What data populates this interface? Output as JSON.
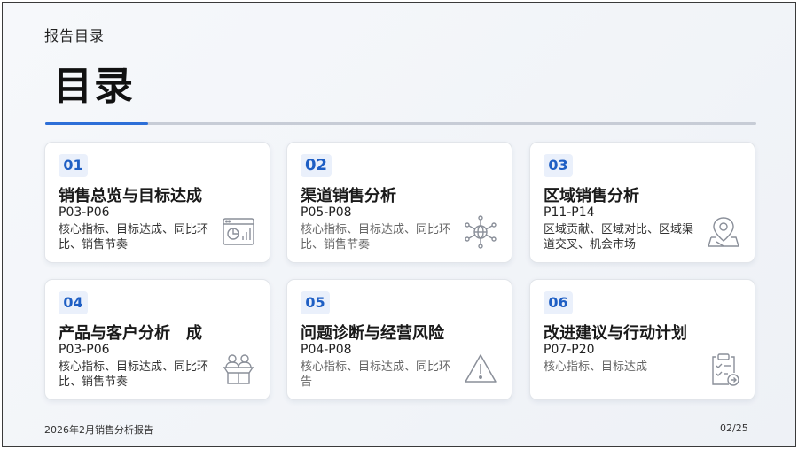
{
  "header": {
    "section_label": "报告目录",
    "title": "目录"
  },
  "cards": [
    {
      "num": "01",
      "title": "销售总览与目标达成",
      "range": "P03-P06",
      "desc": "核心指标、目标达成、同比环比、销售节奏",
      "icon": "dashboard-chart-icon"
    },
    {
      "num": "02",
      "title": "渠道销售分析",
      "range": "P05-P08",
      "desc": "核心指标、目标达成、同比环比、销售节奏",
      "icon": "globe-network-icon"
    },
    {
      "num": "03",
      "title": "区域销售分析",
      "range": "P11-P14",
      "desc": "区域贡献、区域对比、区域渠道交叉、机会市场",
      "icon": "map-pin-icon"
    },
    {
      "num": "04",
      "title": "产品与客户分析　成",
      "range": "P03-P06",
      "desc": "核心指标、目标达成、同比环比、销售节奏",
      "icon": "people-box-icon"
    },
    {
      "num": "05",
      "title": "问题诊断与经营风险",
      "range": "P04-P08",
      "desc": "核心指标、目标达成、同比环告",
      "icon": "warning-icon"
    },
    {
      "num": "06",
      "title": "改进建议与行动计划",
      "range": "P07-P20",
      "desc": "核心指标、目标达成",
      "icon": "clipboard-check-icon"
    }
  ],
  "footer": {
    "report_name": "2026年2月销售分析报告",
    "page_number": "02/25"
  },
  "colors": {
    "accent": "#2d6fd8",
    "number_text": "#1f5fc4",
    "number_bg": "#eaf0fb"
  }
}
